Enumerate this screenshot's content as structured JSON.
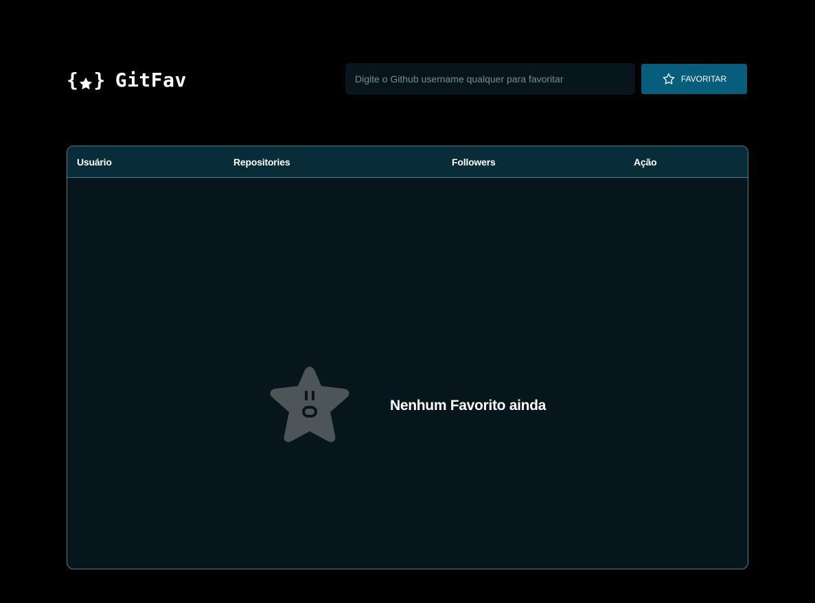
{
  "app": {
    "title": "GitFav",
    "brace_open": "{",
    "brace_close": "}"
  },
  "search": {
    "placeholder": "Digite o Github username qualquer para favoritar",
    "value": ""
  },
  "favorite_button": {
    "label": "FAVORITAR",
    "icon": "star-outline-icon"
  },
  "table": {
    "columns": [
      "Usuário",
      "Repositories",
      "Followers",
      "Ação"
    ],
    "rows": []
  },
  "empty_state": {
    "message": "Nenhum Favorito ainda",
    "icon": "surprised-star-icon"
  },
  "colors": {
    "background": "#000000",
    "table_body": "#06161c",
    "table_header": "#092d38",
    "table_border": "#4a808c",
    "button": "#065e7c",
    "empty_star": "#4e5558"
  }
}
